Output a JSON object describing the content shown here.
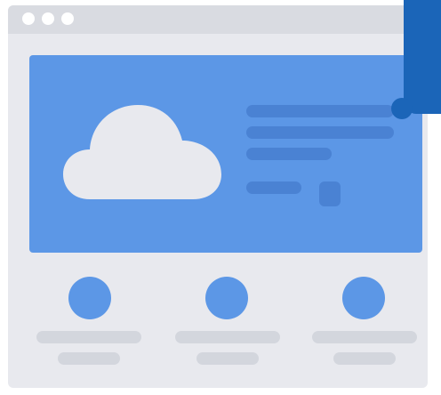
{
  "illustration": {
    "window_controls": [
      "dot",
      "dot",
      "dot"
    ],
    "hero_icon": "cloud-icon",
    "feature_count": 3
  },
  "colors": {
    "accent": "#5c97e6",
    "accent_dark": "#4a82d3",
    "window_bg": "#e8e9ee",
    "titlebar": "#d9dbe1",
    "placeholder": "#d3d6dd",
    "corner_tab": "#1b65b8"
  }
}
